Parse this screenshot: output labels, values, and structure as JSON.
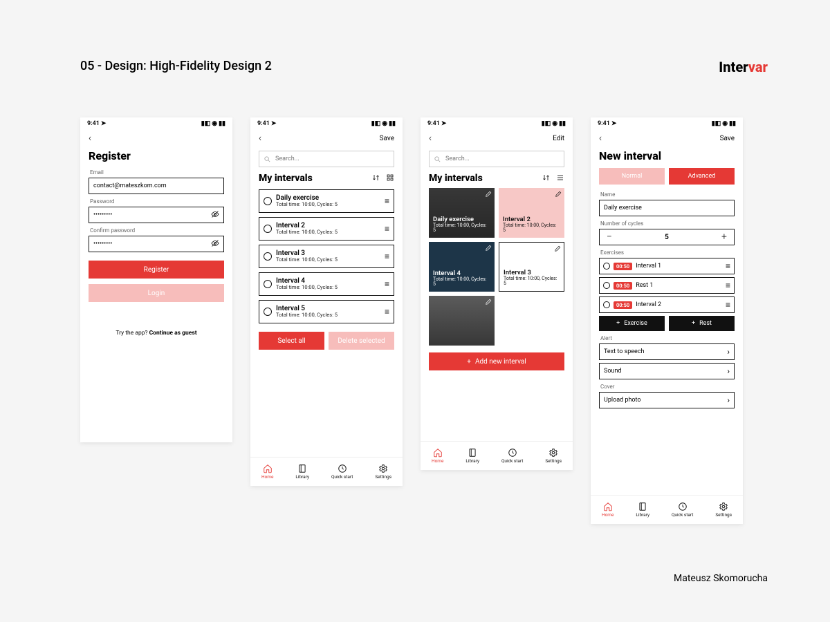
{
  "page": {
    "title": "05 - Design: High-Fidelity Design 2",
    "brand_pre": "Inter",
    "brand_accent": "var",
    "author": "Mateusz Skomorucha"
  },
  "status": {
    "time": "9:41"
  },
  "screen1": {
    "title": "Register",
    "email_label": "Email",
    "email_value": "contact@mateszkom.com",
    "password_label": "Password",
    "password_value": "•••••••••",
    "confirm_label": "Confirm password",
    "confirm_value": "•••••••••",
    "register_btn": "Register",
    "login_btn": "Login",
    "try_prefix": "Try the app? ",
    "try_bold": "Continue as guest"
  },
  "screen2": {
    "nav_action": "Save",
    "search_placeholder": "Search...",
    "title": "My intervals",
    "items": [
      {
        "title": "Daily exercise",
        "sub": "Total time: 10:00, Cycles: 5"
      },
      {
        "title": "Interval 2",
        "sub": "Total time: 10:00, Cycles: 5"
      },
      {
        "title": "Interval 3",
        "sub": "Total time: 10:00, Cycles: 5"
      },
      {
        "title": "Interval 4",
        "sub": "Total time: 10:00, Cycles: 5"
      },
      {
        "title": "Interval 5",
        "sub": "Total time: 10:00, Cycles: 5"
      }
    ],
    "select_all": "Select all",
    "delete_selected": "Delete selected"
  },
  "screen3": {
    "nav_action": "Edit",
    "search_placeholder": "Search...",
    "title": "My intervals",
    "cards": [
      {
        "title": "Daily exercise",
        "sub": "Total time: 10:00, Cycles: 5"
      },
      {
        "title": "Interval 2",
        "sub": "Total time: 10:00, Cycles: 5"
      },
      {
        "title": "Interval 4",
        "sub": "Total time: 10:00, Cycles: 5"
      },
      {
        "title": "Interval 3",
        "sub": "Total time: 10:00, Cycles: 5"
      }
    ],
    "add_new": "Add new interval"
  },
  "screen4": {
    "nav_action": "Save",
    "title": "New interval",
    "seg_normal": "Normal",
    "seg_advanced": "Advanced",
    "name_label": "Name",
    "name_value": "Daily exercise",
    "cycles_label": "Number of cycles",
    "cycles_value": "5",
    "exercises_label": "Exercises",
    "exercises": [
      {
        "time": "00:50",
        "name": "Interval 1"
      },
      {
        "time": "00:50",
        "name": "Rest 1"
      },
      {
        "time": "00:50",
        "name": "Interval 2"
      }
    ],
    "add_exercise": "Exercise",
    "add_rest": "Rest",
    "alert_label": "Alert",
    "alert_tts": "Text to speech",
    "alert_sound": "Sound",
    "cover_label": "Cover",
    "upload_photo": "Upload photo"
  },
  "tabs": {
    "home": "Home",
    "library": "Library",
    "quickstart": "Quick start",
    "settings": "Settings"
  }
}
